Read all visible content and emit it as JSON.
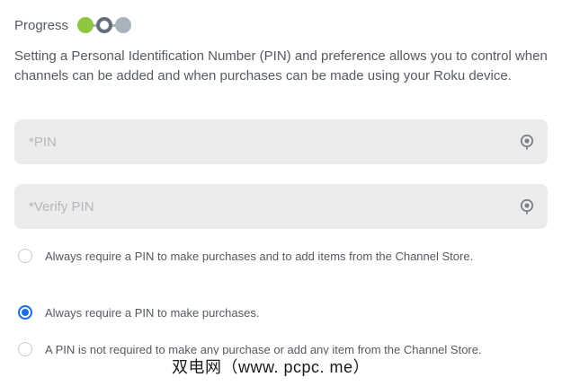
{
  "progress": {
    "label": "Progress",
    "steps": [
      "done",
      "current",
      "todo"
    ]
  },
  "description": "Setting a Personal Identification Number (PIN) and preference allows you to control when channels can be added and when purchases can be made using your Roku device.",
  "fields": {
    "pin": {
      "placeholder": "*PIN",
      "value": "",
      "icon": "eye-icon"
    },
    "verify_pin": {
      "placeholder": "*Verify PIN",
      "value": "",
      "icon": "eye-icon"
    }
  },
  "options": [
    {
      "label": "Always require a PIN to make purchases and to add items from the Channel Store.",
      "selected": false
    },
    {
      "label": "Always require a PIN to make purchases.",
      "selected": true
    },
    {
      "label": "A PIN is not required to make any purchase or add any item from the Channel Store.",
      "selected": false
    }
  ],
  "watermark": "双电网（www. pcpc. me）",
  "colors": {
    "progress_done": "#8dc63f",
    "progress_current": "#66707a",
    "progress_todo": "#a9b3bd",
    "radio_selected": "#1d6fe0",
    "field_background": "#ececec",
    "text": "#555a61"
  }
}
